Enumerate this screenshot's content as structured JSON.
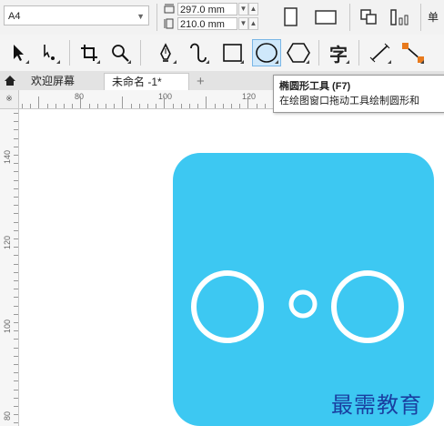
{
  "property_bar": {
    "page_size": "A4",
    "width_value": "297.0 mm",
    "height_value": "210.0 mm",
    "unit_label_fragment": "单"
  },
  "toolbox": {
    "tools": [
      {
        "name": "pick-tool",
        "icon": "arrow-pointer-icon"
      },
      {
        "name": "shape-tool",
        "icon": "node-shape-icon"
      },
      {
        "name": "crop-tool",
        "icon": "crop-icon"
      },
      {
        "name": "zoom-tool",
        "icon": "magnifier-icon"
      },
      {
        "name": "pen-tool",
        "icon": "pen-nib-icon"
      },
      {
        "name": "artistic-media-tool",
        "icon": "curve-icon"
      },
      {
        "name": "rectangle-tool",
        "icon": "rectangle-icon"
      },
      {
        "name": "ellipse-tool",
        "icon": "ellipse-icon",
        "active": true
      },
      {
        "name": "polygon-tool",
        "icon": "hexagon-icon"
      },
      {
        "name": "text-tool",
        "icon": "text-icon",
        "glyph": "字"
      },
      {
        "name": "dimension-tool",
        "icon": "diagonal-line-icon"
      },
      {
        "name": "connector-tool",
        "icon": "connector-icon"
      }
    ]
  },
  "tabs": {
    "welcome": "欢迎屏幕",
    "document": "未命名 -1*",
    "add": "+"
  },
  "tooltip": {
    "title": "椭圆形工具 (F7)",
    "description": "在绘图窗口拖动工具绘制圆形和"
  },
  "rulers": {
    "corner_label": "※",
    "horizontal_labels": [
      "80",
      "100",
      "120"
    ],
    "vertical_labels": [
      "140",
      "120",
      "100",
      "80"
    ]
  },
  "artwork": {
    "tile_color": "#3dc8f2",
    "stroke_color": "#ffffff"
  },
  "watermark": "最需教育"
}
